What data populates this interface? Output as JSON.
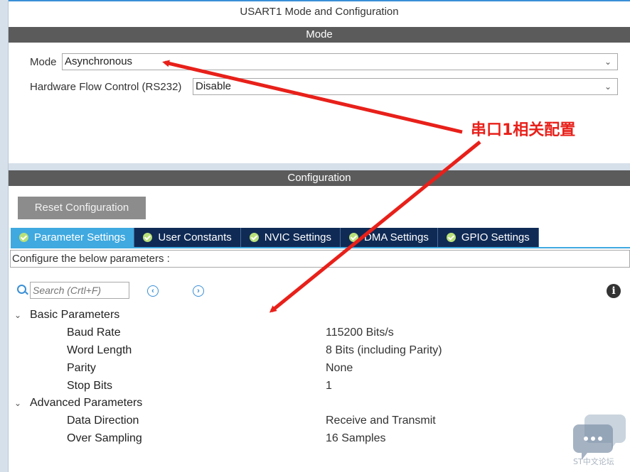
{
  "panel_title": "USART1 Mode and Configuration",
  "mode_section": {
    "header": "Mode",
    "mode_label": "Mode",
    "mode_value": "Asynchronous",
    "flow_label": "Hardware Flow Control (RS232)",
    "flow_value": "Disable"
  },
  "config_section": {
    "header": "Configuration",
    "reset_button": "Reset Configuration",
    "tabs": [
      {
        "label": "Parameter Settings",
        "active": true
      },
      {
        "label": "User Constants",
        "active": false
      },
      {
        "label": "NVIC Settings",
        "active": false
      },
      {
        "label": "DMA Settings",
        "active": false
      },
      {
        "label": "GPIO Settings",
        "active": false
      }
    ],
    "description": "Configure the below parameters :",
    "search_placeholder": "Search (Crtl+F)",
    "nav_prev": "‹",
    "nav_next": "›",
    "info": "i"
  },
  "parameters": {
    "basic": {
      "title": "Basic Parameters",
      "items": [
        {
          "name": "Baud Rate",
          "value": "115200 Bits/s"
        },
        {
          "name": "Word Length",
          "value": "8 Bits (including Parity)"
        },
        {
          "name": "Parity",
          "value": "None"
        },
        {
          "name": "Stop Bits",
          "value": "1"
        }
      ]
    },
    "advanced": {
      "title": "Advanced Parameters",
      "items": [
        {
          "name": "Data Direction",
          "value": "Receive and Transmit"
        },
        {
          "name": "Over Sampling",
          "value": "16 Samples"
        }
      ]
    }
  },
  "annotation": {
    "text": "串口1相关配置",
    "color": "#e8201a"
  },
  "watermark": {
    "text": "ST中文论坛"
  },
  "colors": {
    "tab_active": "#3fa9e0",
    "tab_inactive": "#0f2a55",
    "section_bar": "#5b5b5b",
    "accent": "#3a8fd6"
  }
}
